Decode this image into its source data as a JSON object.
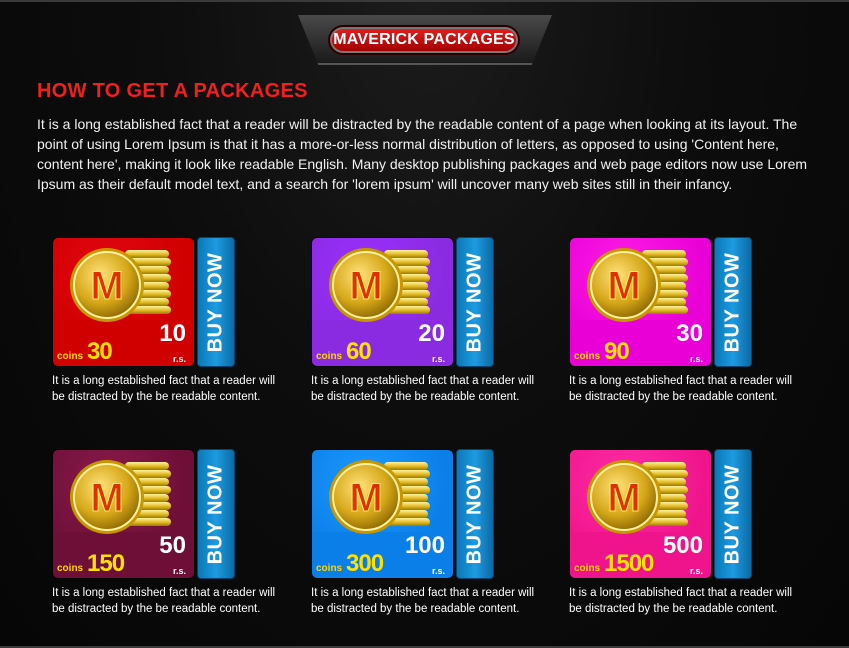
{
  "header": {
    "banner_label": "MAVERICK PACKAGES"
  },
  "section": {
    "title": "HOW TO GET A PACKAGES",
    "intro": "It is a long established fact that a reader will be distracted by the readable content of a page when looking at its layout. The point of using Lorem Ipsum is that it has a more-or-less normal distribution of letters, as opposed to using 'Content here, content here', making it look like readable English. Many desktop publishing packages and web page editors now use Lorem Ipsum as their default model text, and a search for 'lorem ipsum' will uncover many web sites still in their infancy."
  },
  "packages": [
    {
      "coins_label": "coins",
      "coins": "30",
      "price": "10",
      "price_unit": "r.s.",
      "buy_label": "BUY NOW",
      "description": "It is a long established fact that a reader will be distracted by the be readable content.",
      "top_color": "#e30613",
      "bottom_color": "#d00000"
    },
    {
      "coins_label": "coins",
      "coins": "60",
      "price": "20",
      "price_unit": "r.s.",
      "buy_label": "BUY NOW",
      "description": "It is a long established fact that a reader will be distracted by the be readable content.",
      "top_color": "#9b30ff",
      "bottom_color": "#8a2be2"
    },
    {
      "coins_label": "coins",
      "coins": "90",
      "price": "30",
      "price_unit": "r.s.",
      "buy_label": "BUY NOW",
      "description": "It is a long established fact that a reader will be distracted by the be readable content.",
      "top_color": "#ff1ee6",
      "bottom_color": "#e800d6"
    },
    {
      "coins_label": "coins",
      "coins": "150",
      "price": "50",
      "price_unit": "r.s.",
      "buy_label": "BUY NOW",
      "description": "It is a long established fact that a reader will be distracted by the be readable content.",
      "top_color": "#8a1a4a",
      "bottom_color": "#6e0f38"
    },
    {
      "coins_label": "coins",
      "coins": "300",
      "price": "100",
      "price_unit": "r.s.",
      "buy_label": "BUY NOW",
      "description": "It is a long established fact that a reader will be distracted by the be readable content.",
      "top_color": "#1e9bff",
      "bottom_color": "#0a7fe8"
    },
    {
      "coins_label": "coins",
      "coins": "1500",
      "price": "500",
      "price_unit": "r.s.",
      "buy_label": "BUY NOW",
      "description": "It is a long established fact that a reader will be distracted by the be readable content.",
      "top_color": "#ff2fa8",
      "bottom_color": "#f0148c"
    }
  ],
  "colors": {
    "title_red": "#f02020",
    "buy_blue": "#1d9be0",
    "coin_gold": "#ffe000"
  }
}
